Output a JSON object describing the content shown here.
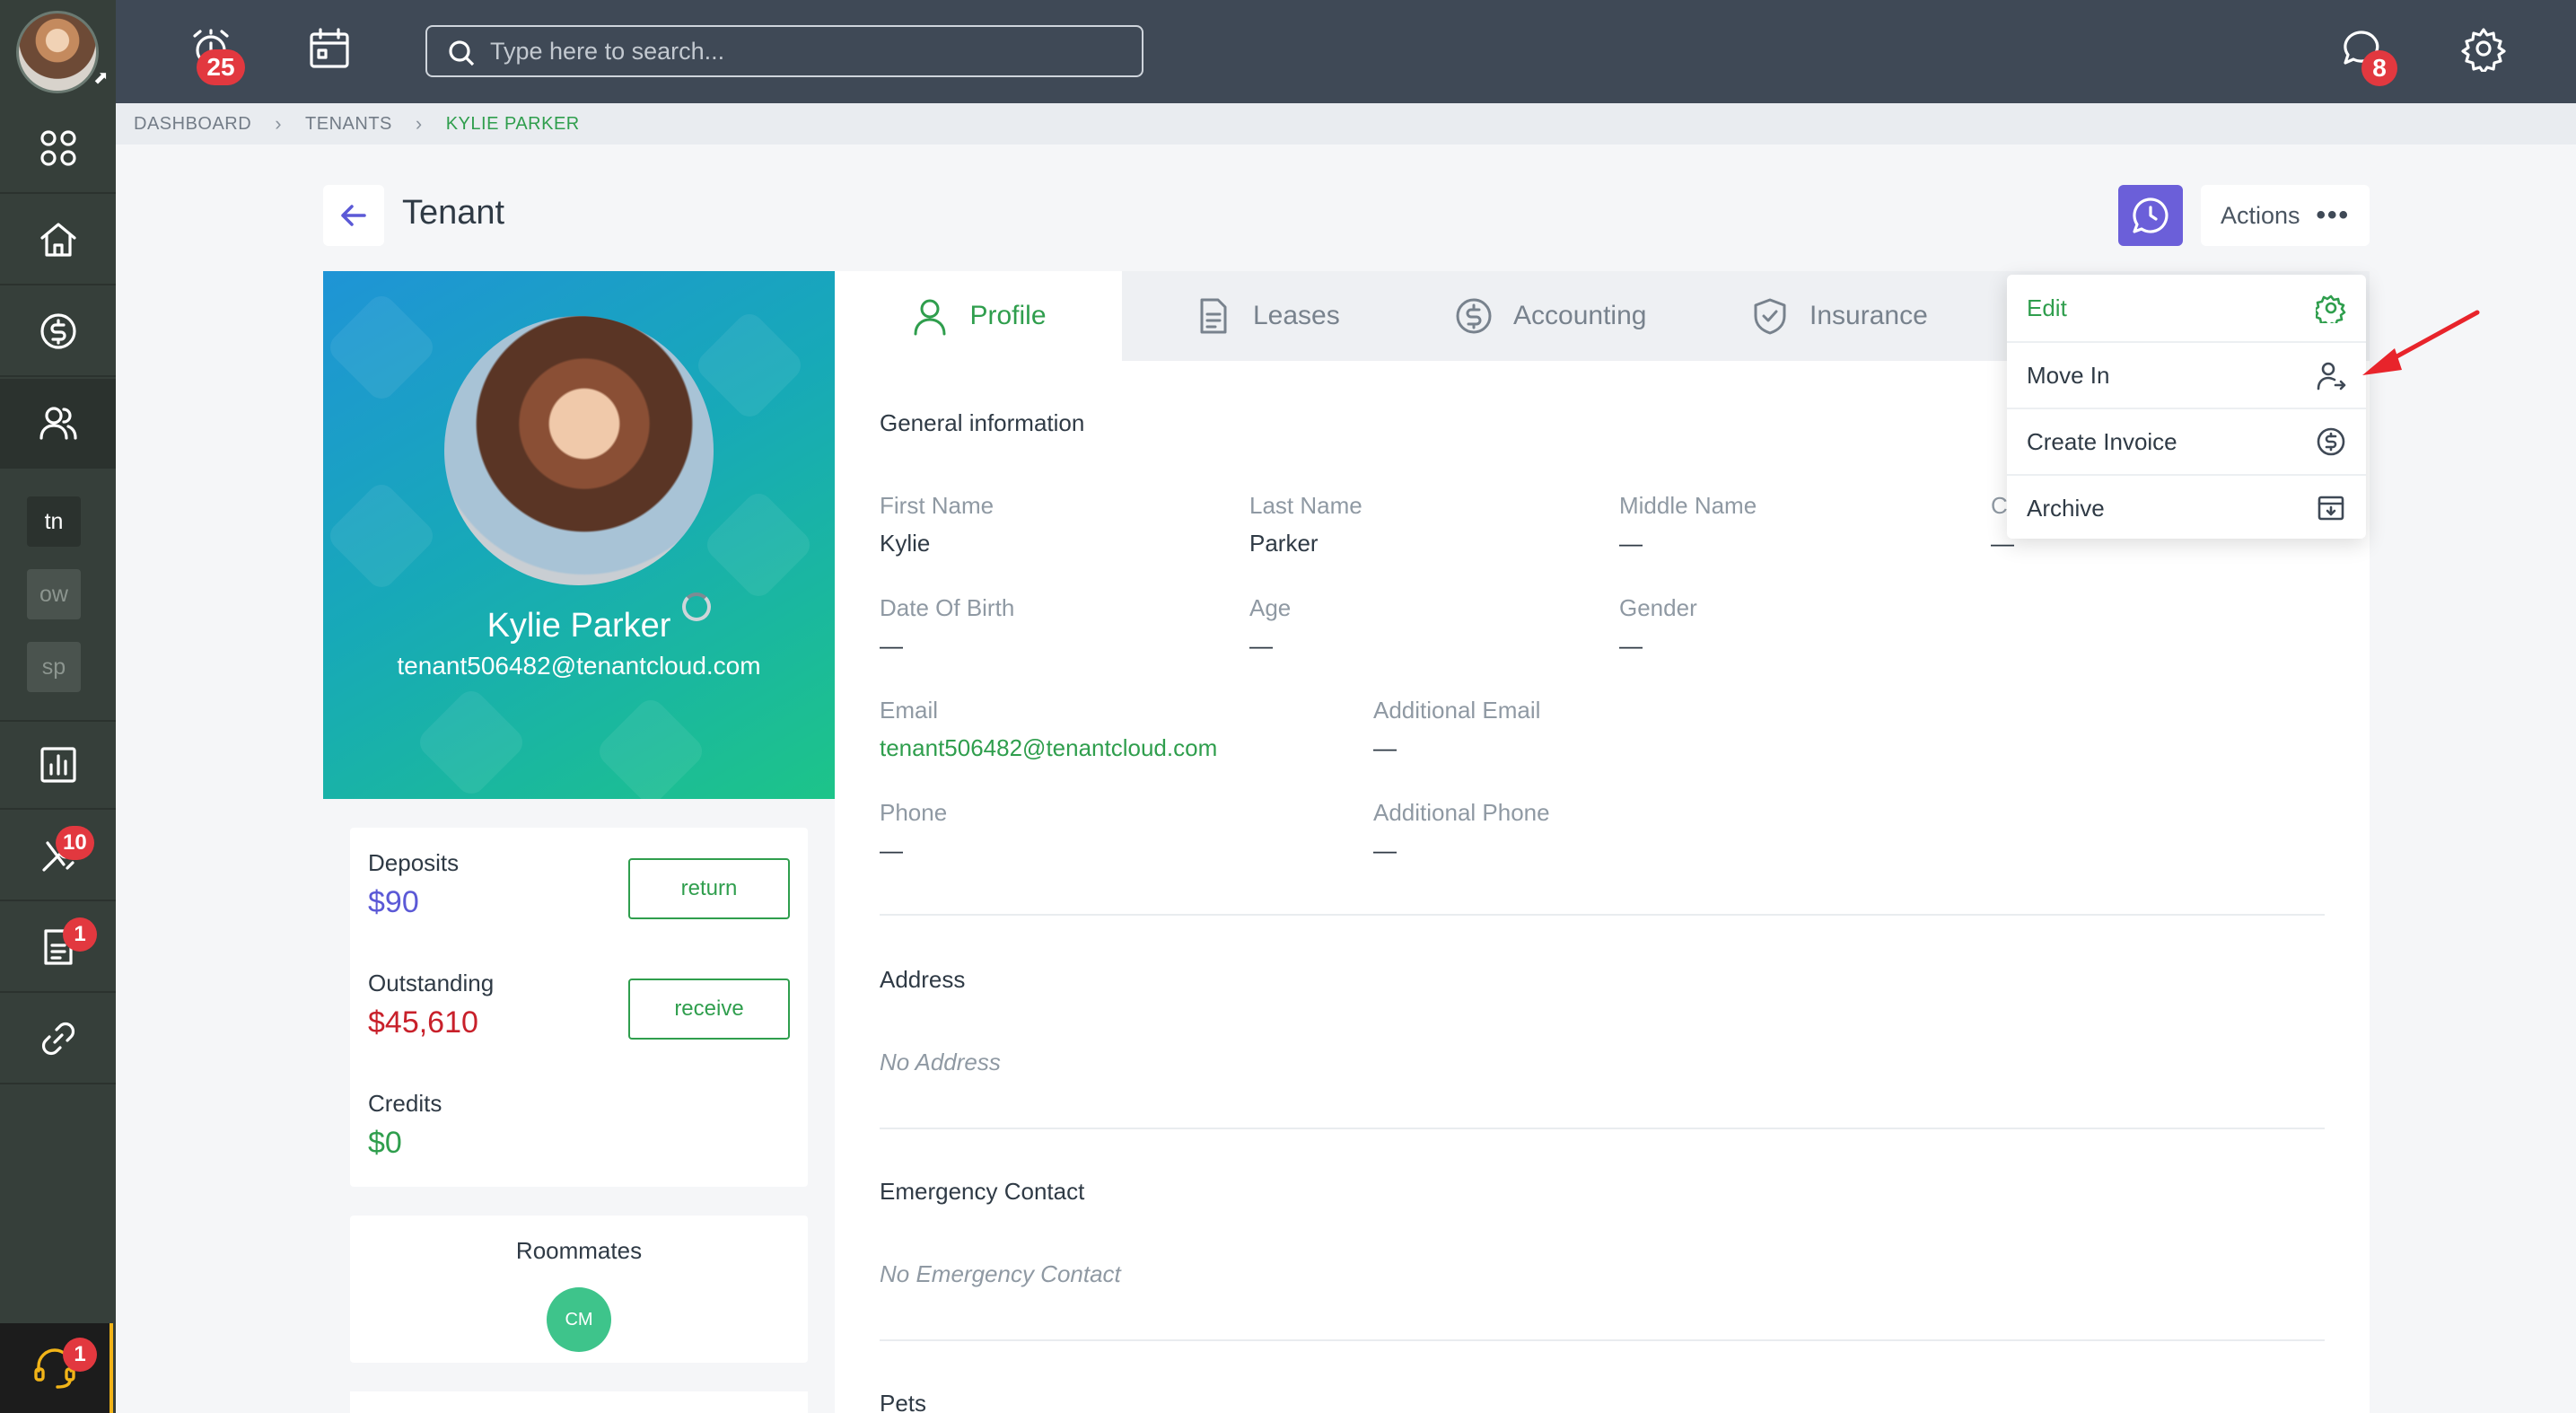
{
  "topbar": {
    "notifications_count": "25",
    "search_placeholder": "Type here to search...",
    "messages_count": "8"
  },
  "rail": {
    "chips": [
      "tn",
      "ow",
      "sp"
    ],
    "maintenance_badge": "10",
    "documents_badge": "1",
    "help_badge": "1"
  },
  "breadcrumb": {
    "items": [
      "DASHBOARD",
      "TENANTS"
    ],
    "current": "KYLIE PARKER"
  },
  "page": {
    "title": "Tenant",
    "actions_label": "Actions"
  },
  "tenant": {
    "name": "Kylie Parker",
    "email": "tenant506482@tenantcloud.com"
  },
  "finance": {
    "deposits_label": "Deposits",
    "deposits_value": "$90",
    "return_label": "return",
    "outstanding_label": "Outstanding",
    "outstanding_value": "$45,610",
    "receive_label": "receive",
    "credits_label": "Credits",
    "credits_value": "$0"
  },
  "roommates": {
    "title": "Roommates",
    "initials": "CM"
  },
  "tabs": [
    "Profile",
    "Leases",
    "Accounting",
    "Insurance"
  ],
  "general": {
    "title": "General information",
    "first_name_label": "First Name",
    "first_name": "Kylie",
    "last_name_label": "Last Name",
    "last_name": "Parker",
    "middle_name_label": "Middle Name",
    "middle_name": "—",
    "hidden_col_label": "C",
    "hidden_col_value": "—",
    "dob_label": "Date Of Birth",
    "dob": "—",
    "age_label": "Age",
    "age": "—",
    "gender_label": "Gender",
    "gender": "—",
    "email_label": "Email",
    "email": "tenant506482@tenantcloud.com",
    "additional_email_label": "Additional Email",
    "additional_email": "—",
    "phone_label": "Phone",
    "phone": "—",
    "additional_phone_label": "Additional Phone",
    "additional_phone": "—"
  },
  "address": {
    "title": "Address",
    "empty": "No Address"
  },
  "emergency": {
    "title": "Emergency Contact",
    "empty": "No Emergency Contact"
  },
  "pets": {
    "title": "Pets"
  },
  "actions_menu": [
    "Edit",
    "Move In",
    "Create Invoice",
    "Archive"
  ],
  "colors": {
    "accent_green": "#2f9e4d",
    "accent_purple": "#6b5fd9",
    "badge_red": "#e2383f",
    "topbar": "#3f4956",
    "rail": "#363f3a"
  }
}
